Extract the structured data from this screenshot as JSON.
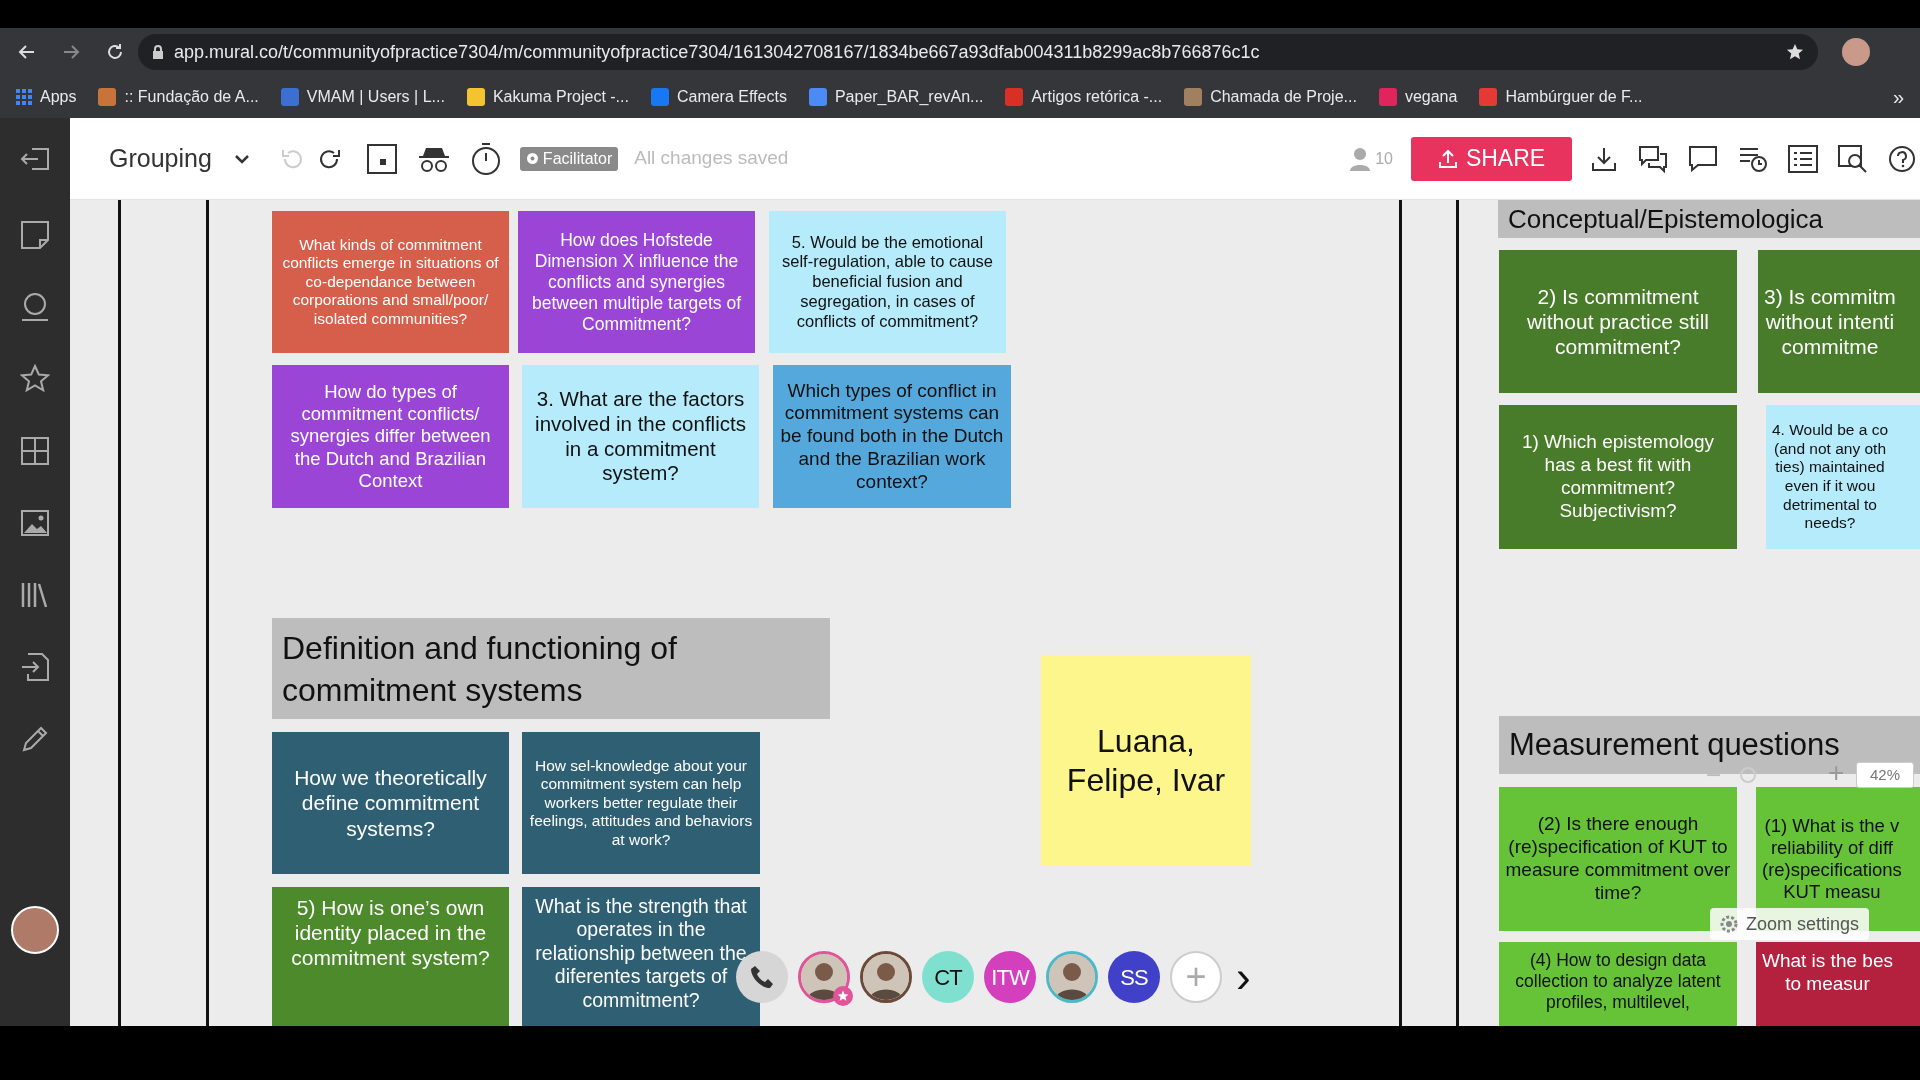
{
  "browser": {
    "url": "app.mural.co/t/communityofpractice7304/m/communityofpractice7304/1613042708167/1834be667a93dfab004311b8299ac8b766876c1c",
    "bookmarks": [
      {
        "label": "Apps",
        "color": "#4285f4"
      },
      {
        "label": ":: Fundação de A...",
        "color": "#c8733a"
      },
      {
        "label": "VMAM | Users | L...",
        "color": "#3b6fd1"
      },
      {
        "label": "Kakuma Project -...",
        "color": "#f4c430"
      },
      {
        "label": "Camera Effects",
        "color": "#1877f2"
      },
      {
        "label": "Paper_BAR_revAn...",
        "color": "#4c8bf5"
      },
      {
        "label": "Artigos retórica -...",
        "color": "#d93025"
      },
      {
        "label": "Chamada de Proje...",
        "color": "#a08060"
      },
      {
        "label": "vegana",
        "color": "#e0245e"
      },
      {
        "label": "Hambúrguer de F...",
        "color": "#e53935"
      }
    ],
    "more": "»"
  },
  "toolbar": {
    "board_title": "Grouping",
    "facilitator_badge": "Facilitator",
    "save_status": "All changes saved",
    "participant_count": "10",
    "share_button": "SHARE"
  },
  "canvas": {
    "headers": [
      {
        "text": "Conceptual/Epistemologica"
      },
      {
        "text": "Definition and functioning of commitment systems"
      },
      {
        "text": "Measurement questions"
      }
    ],
    "stickies": [
      {
        "text": "What kinds of commitment conflicts emerge in situations of co-dependance between corporations and small/poor/ isolated communities?",
        "color": "#d65f4c"
      },
      {
        "text": "How does Hofstede Dimension X influence the conflicts and synergies between multiple targets of Commitment?",
        "color": "#9b45d6"
      },
      {
        "text": "5. Would be the emotional self-regulation, able to cause beneficial fusion and segregation, in cases of conflicts of commitment?",
        "color": "#b5ebfa"
      },
      {
        "text": "How do types of commitment conflicts/ synergies differ between the Dutch and Brazilian Context",
        "color": "#9b45d6"
      },
      {
        "text": "3. What are the factors involved in the conflicts in a commitment system?",
        "color": "#b5ebfa"
      },
      {
        "text": "Which types of conflict in commitment systems can be found both in the Dutch and the Brazilian work context?",
        "color": "#55a8dc"
      },
      {
        "text": "How we theoretically define commitment systems?",
        "color": "#2f5f73"
      },
      {
        "text": "How sel-knowledge about your commitment system can help workers better regulate their feelings, attitudes and behaviors at work?",
        "color": "#2f5f73"
      },
      {
        "text": "5) How is one’s own identity placed in the commitment system?",
        "color": "#4c8a2b"
      },
      {
        "text": "What is the strength that operates in the relationship between the diferentes targets of commitment?",
        "color": "#2f5f73"
      },
      {
        "text": "Luana, Felipe, Ivar",
        "color": "#fdf68c"
      },
      {
        "text": "2) Is commitment without practice still commitment?",
        "color": "#487b2a"
      },
      {
        "text": "3) Is commitm\nwithout intenti\ncommitme",
        "color": "#487b2a"
      },
      {
        "text": "1) Which epistemology has a best fit with commitment? Subjectivism?",
        "color": "#487b2a"
      },
      {
        "text": "4. Would be a co\n(and not any oth\nties) maintained\neven if it wou\ndetrimental to\nneeds?",
        "color": "#b5ebfa"
      },
      {
        "text": "(2) Is there enough (re)specification of KUT to measure commitment over time?",
        "color": "#66c236"
      },
      {
        "text": "(1) What is the v\nreliability of diff\n(re)specifications\nKUT measu",
        "color": "#66c236"
      },
      {
        "text": "(4) How to design data collection to analyze latent profiles, multilevel,",
        "color": "#66c236"
      },
      {
        "text": "What is the bes\nto measur",
        "color": "#b3213f"
      }
    ]
  },
  "zoom": {
    "minus": "−",
    "plus": "+",
    "value": "42%",
    "settings_button": "Zoom settings"
  },
  "collaborators": [
    {
      "kind": "photo",
      "color": "#e0559a",
      "star": true
    },
    {
      "kind": "photo",
      "color": "#6b4a3a",
      "star": false
    },
    {
      "kind": "initials",
      "initials": "CT",
      "color": "#7fe0cf"
    },
    {
      "kind": "initials",
      "initials": "ITW",
      "color": "#d43fbd"
    },
    {
      "kind": "photo",
      "color": "#4fb8c8",
      "star": false
    },
    {
      "kind": "initials",
      "initials": "SS",
      "color": "#4040c8"
    },
    {
      "kind": "add",
      "label": "+"
    },
    {
      "kind": "next",
      "label": "›"
    }
  ]
}
